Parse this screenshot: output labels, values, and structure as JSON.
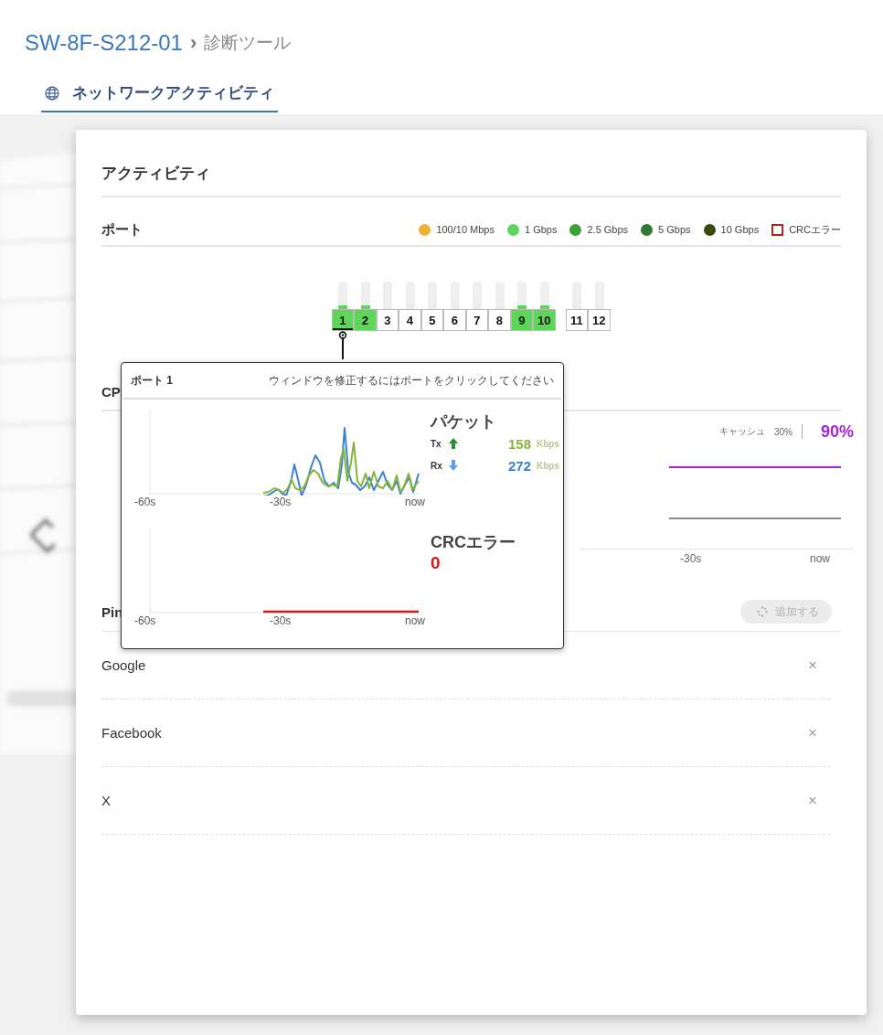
{
  "breadcrumb": {
    "device": "SW-8F-S212-01",
    "separator": "›",
    "page": "診断ツール"
  },
  "tabs": [
    {
      "label": "ネットワークアクティビティ",
      "selected": true
    }
  ],
  "card": {
    "title": "アクティビティ",
    "ports_section": {
      "title": "ポート",
      "legend": [
        {
          "label": "100/10 Mbps",
          "kind": "dot",
          "color": "#f2b134"
        },
        {
          "label": "1 Gbps",
          "kind": "dot",
          "color": "#5ed65a"
        },
        {
          "label": "2.5 Gbps",
          "kind": "dot",
          "color": "#3ca234"
        },
        {
          "label": "5 Gbps",
          "kind": "dot",
          "color": "#2e7a32"
        },
        {
          "label": "10 Gbps",
          "kind": "dot",
          "color": "#3b4a10"
        },
        {
          "label": "CRCエラー",
          "kind": "square",
          "color": "#b3221c"
        }
      ],
      "groups": [
        {
          "ports": [
            {
              "label": "1",
              "color": "#5ed65a",
              "selected": true
            },
            {
              "label": "2",
              "color": "#5ed65a",
              "selected": false
            },
            {
              "label": "3",
              "selected": false
            },
            {
              "label": "4",
              "selected": false
            },
            {
              "label": "5",
              "selected": false
            },
            {
              "label": "6",
              "selected": false
            },
            {
              "label": "7",
              "selected": false
            },
            {
              "label": "8",
              "selected": false
            },
            {
              "label": "9",
              "color": "#5ed65a",
              "selected": false
            },
            {
              "label": "10",
              "color": "#5ed65a",
              "selected": false
            }
          ]
        },
        {
          "ports": [
            {
              "label": "11",
              "selected": false
            },
            {
              "label": "12",
              "selected": false
            }
          ]
        }
      ]
    },
    "cpu_section": {
      "title": "CP",
      "cache_label": "キャッシュ",
      "cache_value": "30%",
      "value": "90%",
      "x_labels": [
        "-30s",
        "now"
      ]
    },
    "ping_section": {
      "title": "Pin",
      "add_button": {
        "label": "追加する",
        "disabled": true
      },
      "hosts": [
        {
          "name": "Google",
          "remove": "×"
        },
        {
          "name": "Facebook",
          "remove": "×"
        },
        {
          "name": "X",
          "remove": "×"
        }
      ]
    },
    "popup": {
      "title": "ポート 1",
      "hint": "ウィンドウを修正するにはポートをクリックしてください",
      "x_labels": [
        "-60s",
        "-30s",
        "now"
      ],
      "packets": {
        "title": "パケット",
        "rows": [
          {
            "label": "Tx",
            "kind": "up",
            "value": "158",
            "unit": "Kbps"
          },
          {
            "label": "Rx",
            "kind": "down",
            "value": "272",
            "unit": "Kbps"
          }
        ]
      },
      "crc": {
        "title": "CRCエラー",
        "value": "0",
        "x_labels": [
          "-60s",
          "-30s",
          "now"
        ]
      }
    }
  }
}
